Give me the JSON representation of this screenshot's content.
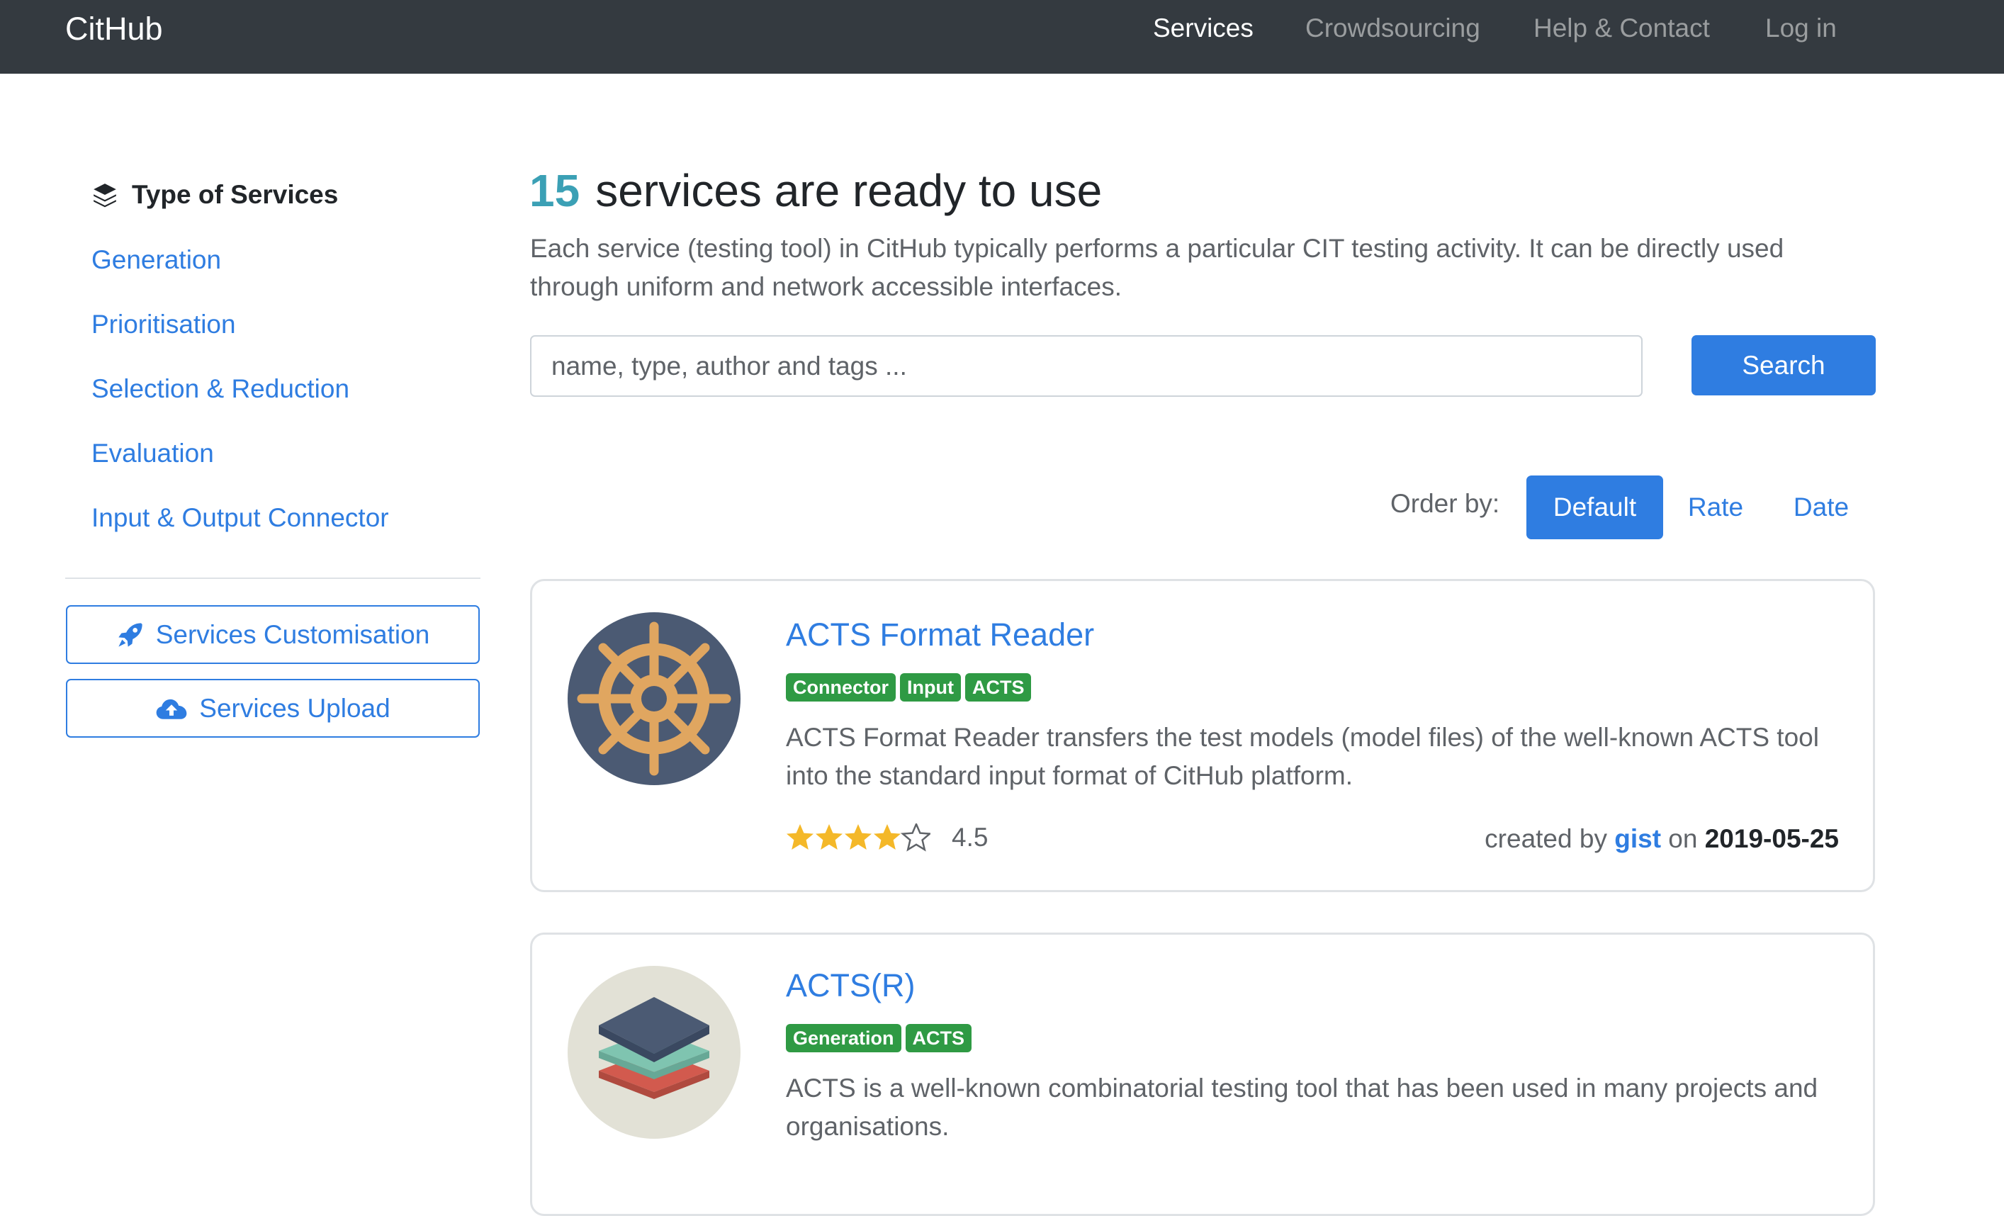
{
  "navbar": {
    "brand": "CitHub",
    "links": [
      "Services",
      "Crowdsourcing",
      "Help & Contact",
      "Log in"
    ],
    "active": "Services"
  },
  "sidebar": {
    "heading": "Type of Services",
    "links": [
      "Generation",
      "Prioritisation",
      "Selection & Reduction",
      "Evaluation",
      "Input & Output Connector"
    ],
    "buttons": {
      "customisation": "Services Customisation",
      "upload": "Services Upload"
    }
  },
  "main": {
    "count": "15",
    "headline": "services are ready to use",
    "intro": "Each service (testing tool) in CitHub typically performs a particular CIT testing activity. It can be directly used through uniform and network accessible interfaces.",
    "search": {
      "placeholder": "name, type, author and tags ...",
      "button": "Search"
    },
    "order": {
      "label": "Order by:",
      "options": [
        "Default",
        "Rate",
        "Date"
      ],
      "selected": "Default"
    }
  },
  "services": [
    {
      "title": "ACTS Format Reader",
      "icon": "ship-wheel-icon",
      "tags": [
        "Connector",
        "Input",
        "ACTS"
      ],
      "description": "ACTS Format Reader transfers the test models (model files) of the well-known ACTS tool into the standard input format of CitHub platform.",
      "rating": "4.5",
      "created_prefix": "created by",
      "author": "gist",
      "on": "on",
      "date": "2019-05-25"
    },
    {
      "title": "ACTS(R)",
      "icon": "layers-icon",
      "tags": [
        "Generation",
        "ACTS"
      ],
      "description": "ACTS is a well-known combinatorial testing tool that has been used in many projects and organisations."
    }
  ],
  "colors": {
    "navbar": "#343a40",
    "primary": "#2f7de1",
    "badge": "#2f9a44",
    "count": "#3ba0b5",
    "star": "#f4b829"
  }
}
